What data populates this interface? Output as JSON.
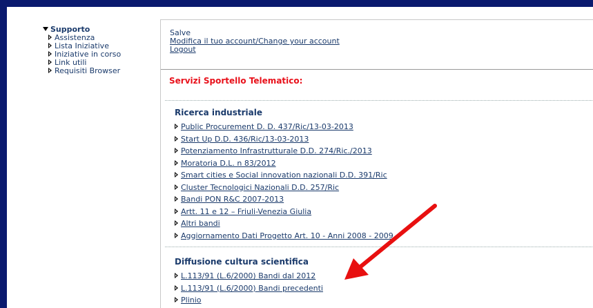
{
  "sidebar": {
    "heading": "Supporto",
    "items": [
      {
        "label": "Assistenza"
      },
      {
        "label": "Lista Iniziative"
      },
      {
        "label": "Iniziative in corso"
      },
      {
        "label": "Link utili"
      },
      {
        "label": "Requisiti Browser"
      }
    ]
  },
  "account": {
    "greeting": "Salve",
    "modify_label": "Modifica il tuo account/Change your account",
    "logout_label": "Logout"
  },
  "main": {
    "section_title": "Servizi Sportello Telematico:",
    "groups": [
      {
        "title": "Ricerca industriale",
        "links": [
          "Public Procurement D. D. 437/Ric/13-03-2013",
          "Start Up D.D. 436/Ric/13-03-2013",
          "Potenziamento Infrastrutturale D.D. 274/Ric./2013",
          "Moratoria D.L. n 83/2012",
          "Smart cities e Social innovation nazionali D.D. 391/Ric",
          "Cluster Tecnologici Nazionali D.D. 257/Ric",
          "Bandi PON R&C 2007-2013",
          "Artt. 11 e 12 – Friuli-Venezia Giulia",
          "Altri bandi",
          "Aggiornamento Dati Progetto Art. 10 - Anni 2008 - 2009"
        ]
      },
      {
        "title": "Diffusione cultura scientifica",
        "links": [
          "L.113/91 (L.6/2000) Bandi dal 2012",
          "L.113/91 (L.6/2000) Bandi precedenti",
          "Plinio"
        ]
      }
    ]
  },
  "colors": {
    "frame": "#0a1a6e",
    "link": "#1a3a6b",
    "section_title": "#e8101a",
    "annotation_arrow": "#e81010"
  }
}
